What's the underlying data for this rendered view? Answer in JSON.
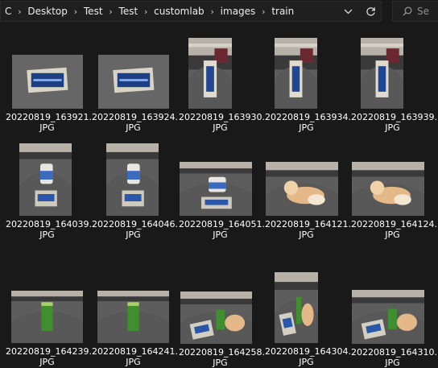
{
  "address_bar": {
    "crumbs": [
      "C",
      "Desktop",
      "Test",
      "Test",
      "customlab",
      "images",
      "train"
    ],
    "separator": "›"
  },
  "search": {
    "placeholder": "Se"
  },
  "files": [
    {
      "name": "20220819_163921.",
      "ext": "JPG",
      "scene": "sign"
    },
    {
      "name": "20220819_163924.",
      "ext": "JPG",
      "scene": "sign"
    },
    {
      "name": "20220819_163930.",
      "ext": "JPG",
      "scene": "office"
    },
    {
      "name": "20220819_163934.",
      "ext": "JPG",
      "scene": "office"
    },
    {
      "name": "20220819_163939.",
      "ext": "JPG",
      "scene": "office"
    },
    {
      "name": "20220819_164039.",
      "ext": "JPG",
      "scene": "can"
    },
    {
      "name": "20220819_164046.",
      "ext": "JPG",
      "scene": "can"
    },
    {
      "name": "20220819_164051.",
      "ext": "JPG",
      "scene": "can"
    },
    {
      "name": "20220819_164121.",
      "ext": "JPG",
      "scene": "cat"
    },
    {
      "name": "20220819_164124.",
      "ext": "JPG",
      "scene": "cat"
    },
    {
      "name": "20220819_164239.",
      "ext": "JPG",
      "scene": "pringles"
    },
    {
      "name": "20220819_164241.",
      "ext": "JPG",
      "scene": "pringles"
    },
    {
      "name": "20220819_164258.",
      "ext": "JPG",
      "scene": "mixed"
    },
    {
      "name": "20220819_164304.",
      "ext": "JPG",
      "scene": "mixed"
    },
    {
      "name": "20220819_164310.",
      "ext": "JPG",
      "scene": "mixed"
    }
  ]
}
